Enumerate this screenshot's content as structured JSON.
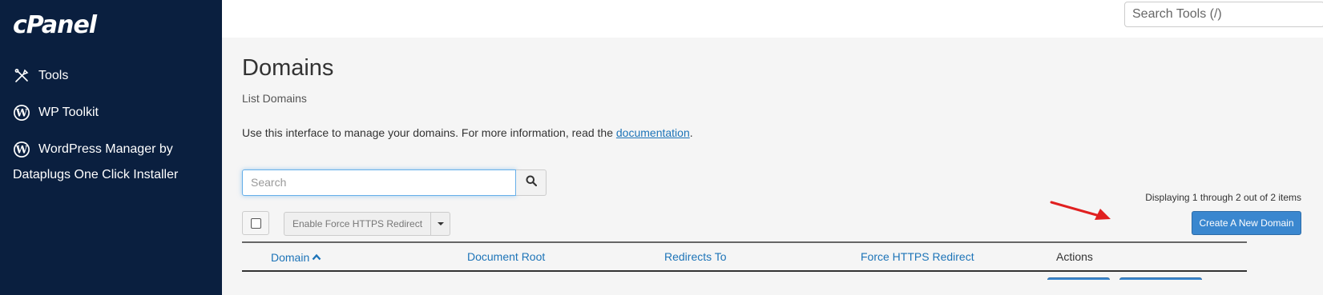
{
  "brand": {
    "logo_text": "cPanel"
  },
  "sidebar": {
    "items": [
      {
        "label": "Tools",
        "icon": "tools-icon"
      },
      {
        "label": "WP Toolkit",
        "icon": "wordpress-icon"
      },
      {
        "label_line1": "WordPress Manager by",
        "label_line2": "Dataplugs One Click Installer",
        "icon": "wordpress-icon"
      }
    ]
  },
  "header": {
    "search_placeholder": "Search Tools (/)"
  },
  "page": {
    "title": "Domains",
    "subtitle": "List Domains",
    "intro_prefix": "Use this interface to manage your domains. For more information, read the ",
    "intro_link": "documentation",
    "intro_suffix": "."
  },
  "search": {
    "placeholder": "Search"
  },
  "toolbar": {
    "displaying": "Displaying 1 through 2 out of 2 items",
    "https_button": "Enable Force HTTPS Redirect",
    "create_button": "Create A New Domain"
  },
  "table": {
    "columns": [
      "Domain",
      "Document Root",
      "Redirects To",
      "Force HTTPS Redirect",
      "Actions"
    ],
    "sort_column": "Domain",
    "sort_direction": "ascending"
  },
  "colors": {
    "sidebar_bg": "#0a1f3f",
    "link": "#1d74b8",
    "primary_button": "#3a87cf",
    "annotation_arrow": "#e02020"
  }
}
